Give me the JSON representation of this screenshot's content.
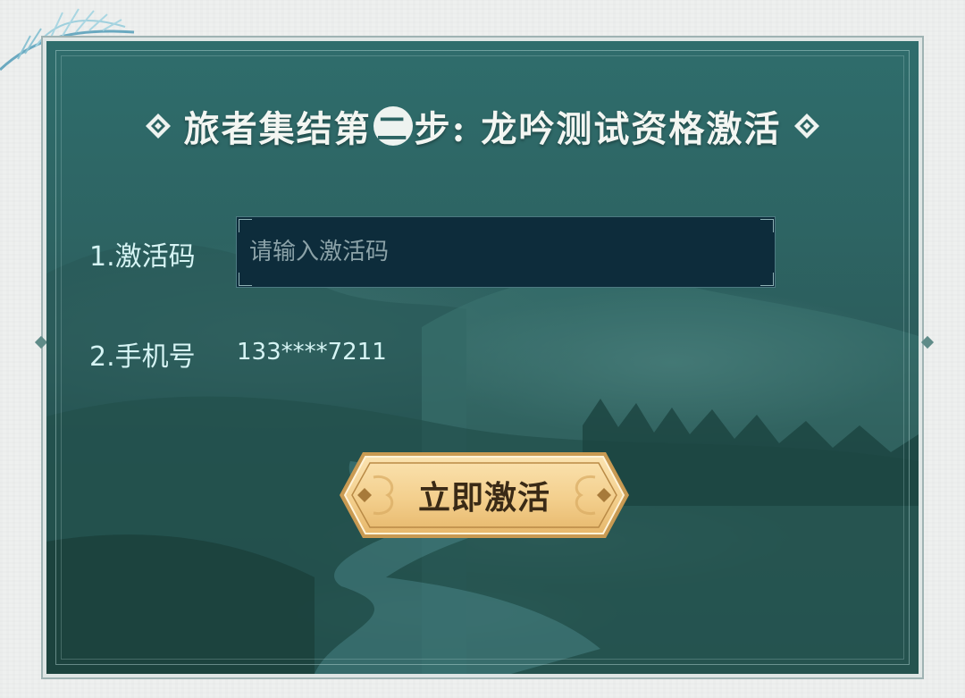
{
  "title": {
    "prefix": "旅者集结第",
    "step_number": "二",
    "suffix": "步: 龙吟测试资格激活"
  },
  "form": {
    "code_label": "1.激活码",
    "code_placeholder": "请输入激活码",
    "code_value": "",
    "phone_label": "2.手机号",
    "phone_value": "133****7211"
  },
  "actions": {
    "activate_label": "立即激活"
  },
  "icons": {
    "title_left": "diamond-ornament-icon",
    "title_right": "diamond-ornament-icon",
    "corner": "feather-ornament-icon"
  },
  "colors": {
    "panel": "#2c5d5c",
    "input_bg": "#0d2c3b",
    "label_text": "#d6f4f4",
    "button_gold": "#f2cf8e"
  }
}
